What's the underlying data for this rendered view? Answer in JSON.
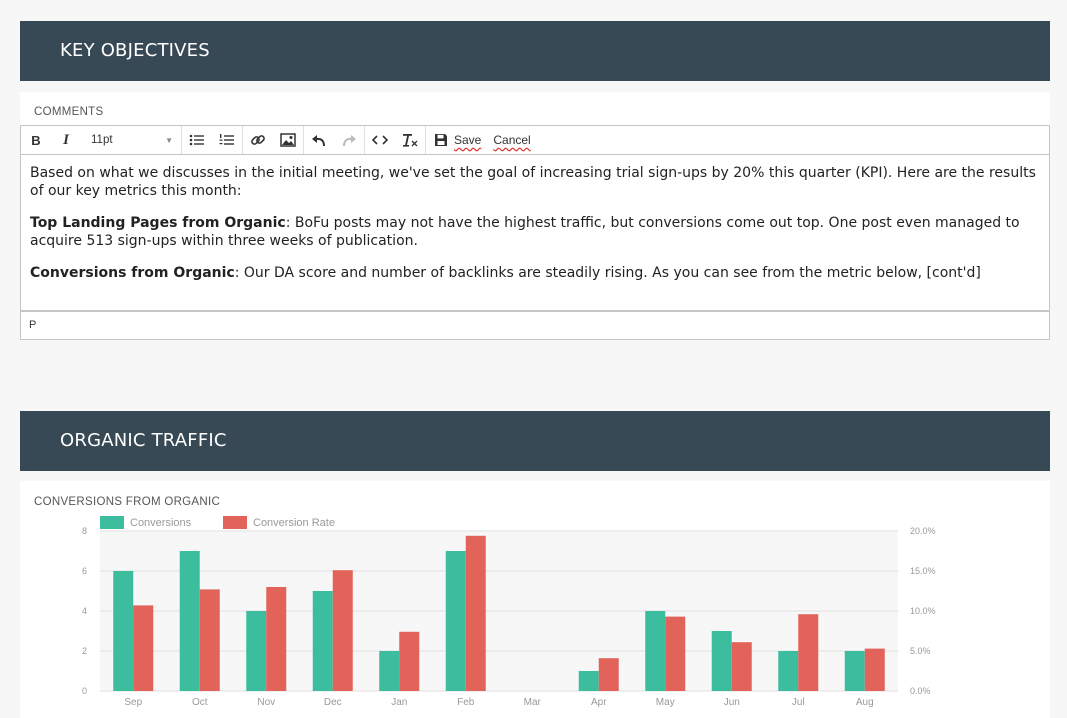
{
  "sections": {
    "objectives_title": "KEY OBJECTIVES",
    "traffic_title": "ORGANIC TRAFFIC"
  },
  "comments": {
    "label": "COMMENTS",
    "toolbar": {
      "bold": "B",
      "italic": "I",
      "font_size": "11pt",
      "save": "Save",
      "cancel": "Cancel"
    },
    "body": {
      "p1": "Based on what we discusses in the initial meeting, we've set the goal of increasing trial sign-ups by 20% this quarter (KPI). Here are the results of our key metrics this month:",
      "p2_bold": "Top Landing Pages from Organic",
      "p2_text": ": BoFu posts may not have the highest traffic, but conversions come out top. One post even managed to acquire 513 sign-ups within three weeks of publication.",
      "p3_bold": "Conversions from Organic",
      "p3_text": ": Our DA score and number of backlinks are steadily rising. As you can see from the metric below, [cont'd]"
    },
    "status_path": "P"
  },
  "chart_data": {
    "type": "bar",
    "title": "CONVERSIONS FROM ORGANIC",
    "categories": [
      "Sep",
      "Oct",
      "Nov",
      "Dec",
      "Jan",
      "Feb",
      "Mar",
      "Apr",
      "May",
      "Jun",
      "Jul",
      "Aug"
    ],
    "series": [
      {
        "name": "Conversions",
        "axis": "left",
        "color": "#3bbd9e",
        "values": [
          6,
          7,
          4,
          5,
          2,
          7,
          0,
          1,
          4,
          3,
          2,
          2
        ]
      },
      {
        "name": "Conversion Rate",
        "axis": "right",
        "color": "#e2635a",
        "values": [
          10.7,
          12.7,
          13.0,
          15.1,
          7.4,
          19.4,
          0,
          4.1,
          9.3,
          6.1,
          9.6,
          5.3
        ]
      }
    ],
    "left_axis": {
      "ylim": [
        0,
        8
      ],
      "ticks": [
        "0",
        "2",
        "4",
        "6",
        "8"
      ]
    },
    "right_axis": {
      "ylim": [
        0,
        20
      ],
      "ticks": [
        "0.0%",
        "5.0%",
        "10.0%",
        "15.0%",
        "20.0%"
      ]
    },
    "grid": true,
    "legend": "top-left"
  }
}
